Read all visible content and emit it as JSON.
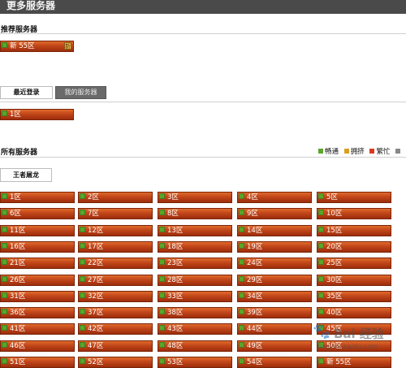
{
  "header": {
    "title": "更多服务器"
  },
  "recommended": {
    "title": "推荐服务器",
    "server": {
      "label": "新 55区",
      "badge": "新"
    }
  },
  "tabs": {
    "recent": "最近登录",
    "mine": "我的服务器"
  },
  "recent_list": [
    {
      "label": "1区"
    }
  ],
  "all_servers": {
    "title": "所有服务器",
    "filter_button": "王者屠龙",
    "legend": [
      {
        "label": "畅通",
        "color": "#5aa52a"
      },
      {
        "label": "拥挤",
        "color": "#d8a020"
      },
      {
        "label": "繁忙",
        "color": "#d83a20"
      },
      {
        "label": "",
        "color": "#888888"
      }
    ],
    "rows": [
      [
        "1区",
        "2区",
        "3区",
        "4区",
        "5区"
      ],
      [
        "6区",
        "7区",
        "8区",
        "9区",
        "10区"
      ],
      [
        "11区",
        "12区",
        "13区",
        "14区",
        "15区"
      ],
      [
        "16区",
        "17区",
        "18区",
        "19区",
        "20区"
      ],
      [
        "21区",
        "22区",
        "23区",
        "24区",
        "25区"
      ],
      [
        "26区",
        "27区",
        "28区",
        "29区",
        "30区"
      ],
      [
        "31区",
        "32区",
        "33区",
        "34区",
        "35区"
      ],
      [
        "36区",
        "37区",
        "38区",
        "39区",
        "40区"
      ],
      [
        "41区",
        "42区",
        "43区",
        "44区",
        "45区"
      ],
      [
        "46区",
        "47区",
        "48区",
        "49区",
        "50区"
      ],
      [
        "51区",
        "52区",
        "53区",
        "54区",
        "新 55区"
      ]
    ]
  },
  "watermark": {
    "main": "Bai 经验",
    "sub": "jingyan.baidu.com"
  },
  "colors": {
    "status_ok": "#5aa52a",
    "button_orange": "#c1461a",
    "header_bg": "#4a4a4a"
  }
}
